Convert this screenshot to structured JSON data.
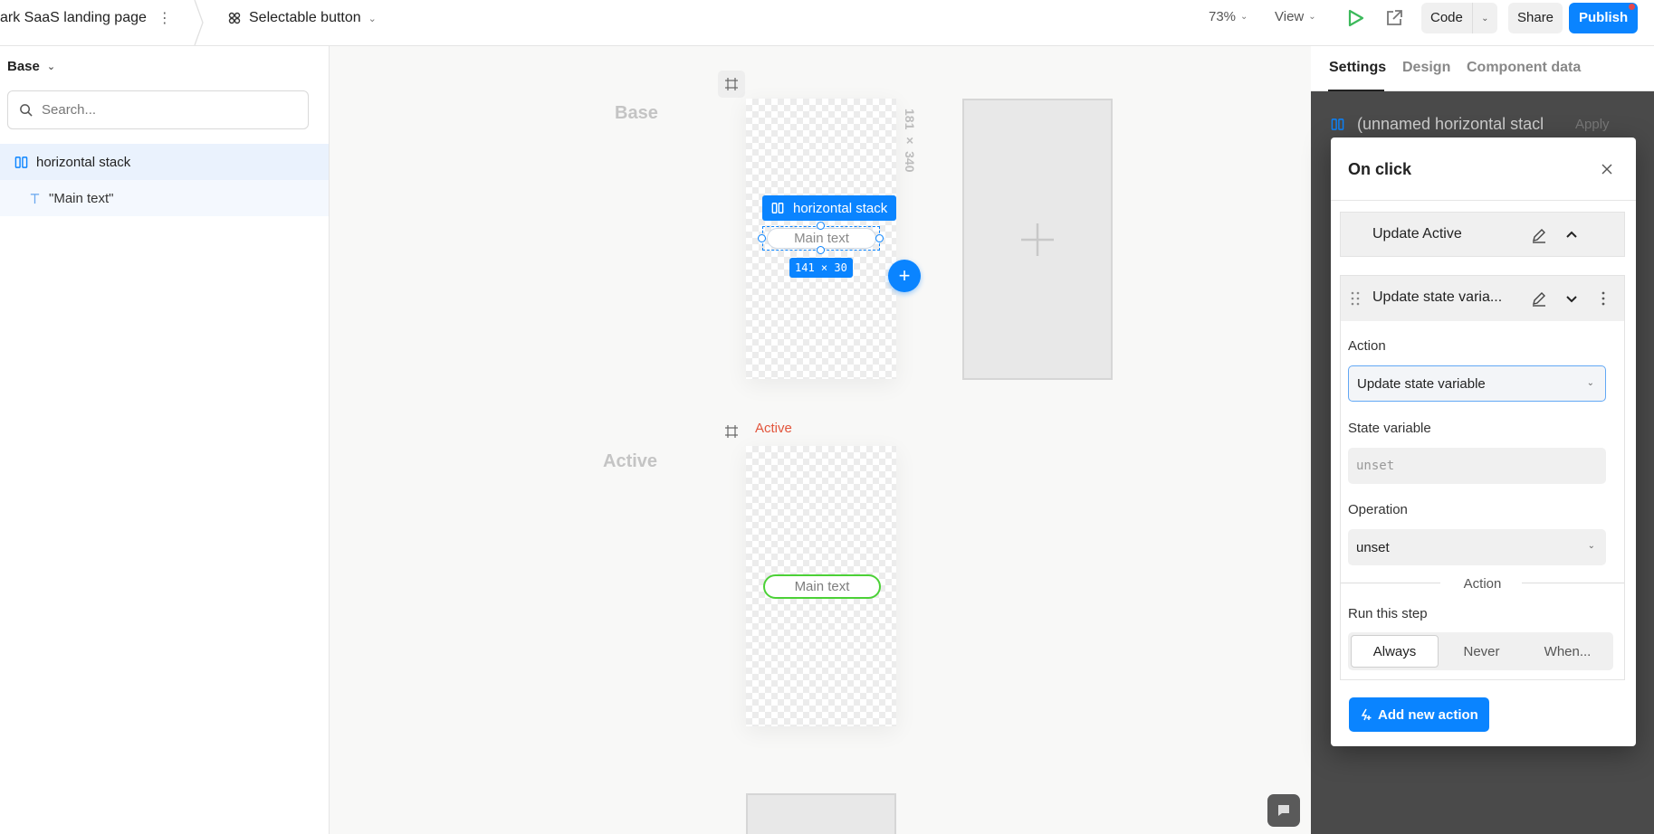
{
  "topbar": {
    "project_name": "ark SaaS landing page",
    "component_name": "Selectable button",
    "zoom": "73%",
    "view_label": "View",
    "code_label": "Code",
    "share_label": "Share",
    "publish_label": "Publish"
  },
  "left": {
    "variant_select": "Base",
    "search_placeholder": "Search...",
    "tree": [
      {
        "label": "horizontal stack",
        "icon": "hstack-icon"
      },
      {
        "label": "\"Main text\"",
        "icon": "text-icon"
      }
    ]
  },
  "canvas": {
    "base_label": "Base",
    "active_label": "Active",
    "artboard_size": "181 × 340",
    "selected_tag": "horizontal stack",
    "pill_text": "Main text",
    "selection_size": "141 × 30",
    "active_variant_tag": "Active",
    "active_pill_text": "Main text"
  },
  "right": {
    "tabs": [
      "Settings",
      "Design",
      "Component data"
    ],
    "active_tab": "Settings",
    "behind_row": "(unnamed horizontal stacl",
    "behind_apply": "Apply",
    "modal": {
      "title": "On click",
      "action1_label": "Update Active",
      "action2_label": "Update state varia...",
      "action_field_label": "Action",
      "action_value": "Update state variable",
      "state_var_label": "State variable",
      "state_var_value": "unset",
      "operation_label": "Operation",
      "operation_value": "unset",
      "divider_label": "Action",
      "run_label": "Run this step",
      "run_options": [
        "Always",
        "Never",
        "When..."
      ],
      "run_selected": "Always",
      "add_button": "Add new action"
    }
  },
  "colors": {
    "accent": "#0a84ff",
    "active_red": "#e2553c",
    "active_green": "#4cd137",
    "play_green": "#3cb95b"
  }
}
